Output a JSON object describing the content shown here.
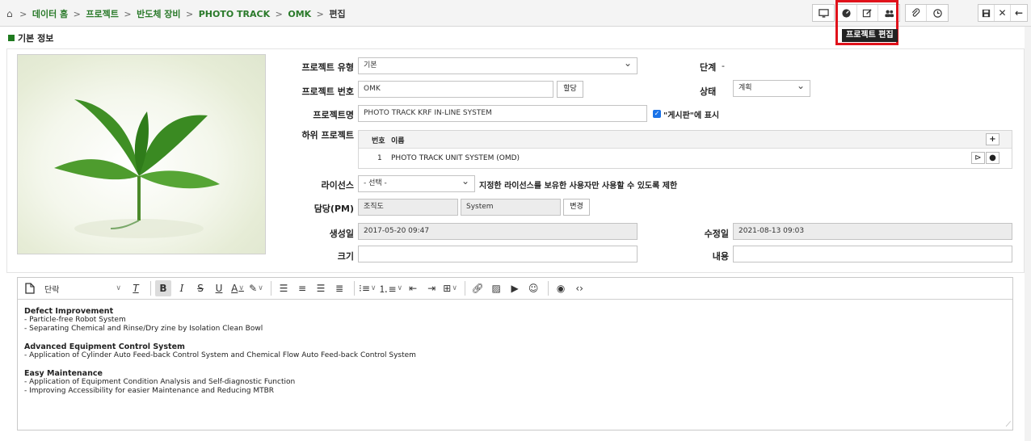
{
  "breadcrumb": {
    "items": [
      "데이터 홈",
      "프로젝트",
      "반도체 장비",
      "PHOTO TRACK",
      "OMK"
    ],
    "current": "편집",
    "separator": ">"
  },
  "toolbar": {
    "tooltip": "프로젝트 편집"
  },
  "section": {
    "title": "기본 정보"
  },
  "form": {
    "project_type_label": "프로젝트 유형",
    "project_type_value": "기본",
    "stage_label": "단계",
    "stage_value": "-",
    "project_no_label": "프로젝트 번호",
    "project_no_value": "OMK",
    "assign_button": "할당",
    "status_label": "상태",
    "status_value": "계획",
    "project_name_label": "프로젝트명",
    "project_name_value": "PHOTO TRACK KRF IN-LINE SYSTEM",
    "board_checkbox_label": "\"게시판\"에 표시",
    "subproject_label": "하위 프로젝트",
    "subproject_headers": {
      "no": "번호",
      "name": "이름"
    },
    "subproject_rows": [
      {
        "no": "1",
        "name": "PHOTO TRACK UNIT SYSTEM (OMD)"
      }
    ],
    "license_label": "라이선스",
    "license_value": "- 선택 -",
    "license_note": "지정한 라이선스를 보유한 사용자만 사용할 수 있도록 제한",
    "pm_label": "담당(PM)",
    "pm_org": "조직도",
    "pm_name": "System",
    "change_button": "변경",
    "created_label": "생성일",
    "created_value": "2017-05-20 09:47",
    "modified_label": "수정일",
    "modified_value": "2021-08-13 09:03",
    "size_label": "크기",
    "size_value": "",
    "content_label": "내용",
    "content_value": ""
  },
  "editor": {
    "paragraph_style": "단락",
    "lines": [
      {
        "text": "Defect Improvement",
        "bold": true
      },
      {
        "text": "- Particle-free Robot System",
        "bold": false
      },
      {
        "text": "- Separating Chemical and Rinse/Dry zine by Isolation Clean Bowl",
        "bold": false
      },
      {
        "text": "",
        "bold": false
      },
      {
        "text": "Advanced Equipment Control System",
        "bold": true
      },
      {
        "text": "- Application of Cylinder Auto Feed-back Control System and Chemical Flow Auto Feed-back Control System",
        "bold": false
      },
      {
        "text": "",
        "bold": false
      },
      {
        "text": "Easy Maintenance",
        "bold": true
      },
      {
        "text": "- Application of Equipment Condition Analysis and Self-diagnostic Function",
        "bold": false
      },
      {
        "text": "- Improving Accessibility for easier Maintenance and Reducing MTBR",
        "bold": false
      }
    ]
  },
  "colors": {
    "accent_green": "#1f7a1f",
    "highlight_red": "#e0121b",
    "checkbox_blue": "#1a73e8"
  }
}
